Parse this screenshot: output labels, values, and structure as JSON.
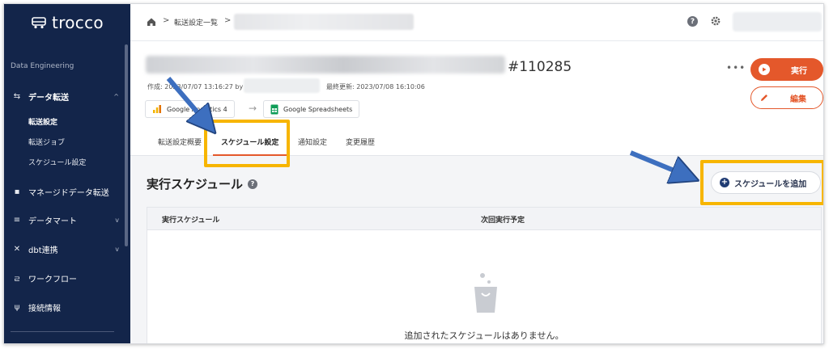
{
  "brand": {
    "name": "trocco"
  },
  "sidebar": {
    "section_label": "Data Engineering",
    "items": [
      {
        "label": "データ転送",
        "icon": "transfer-icon"
      },
      {
        "label": "マネージドデータ転送",
        "icon": "grid-icon"
      },
      {
        "label": "データマート",
        "icon": "database-icon"
      },
      {
        "label": "dbt連携",
        "icon": "dbt-icon"
      },
      {
        "label": "ワークフロー",
        "icon": "workflow-icon"
      },
      {
        "label": "接続情報",
        "icon": "plug-icon"
      }
    ],
    "subitems": [
      {
        "label": "転送設定"
      },
      {
        "label": "転送ジョブ"
      },
      {
        "label": "スケジュール設定"
      }
    ]
  },
  "breadcrumb": {
    "sep": ">",
    "item1": "転送設定一覧"
  },
  "header": {
    "title_id": "#110285",
    "created": "作成: 2023/07/07 13:16:27 by",
    "updated": "最終更新: 2023/07/08 16:10:06",
    "source": "Google Analytics 4",
    "destination": "Google Spreadsheets",
    "more": "•••",
    "run_label": "実行",
    "edit_label": "編集"
  },
  "tabs": [
    {
      "label": "転送設定概要"
    },
    {
      "label": "スケジュール設定"
    },
    {
      "label": "通知設定"
    },
    {
      "label": "変更履歴"
    }
  ],
  "schedule": {
    "title": "実行スケジュール",
    "add_label": "スケジュールを追加",
    "columns": [
      "実行スケジュール",
      "次回実行予定"
    ],
    "empty_message": "追加されたスケジュールはありません。"
  },
  "colors": {
    "accent": "#e4582b",
    "sidebar_bg": "#13254a",
    "highlight": "#f7b500",
    "arrow": "#3d6fbf"
  }
}
